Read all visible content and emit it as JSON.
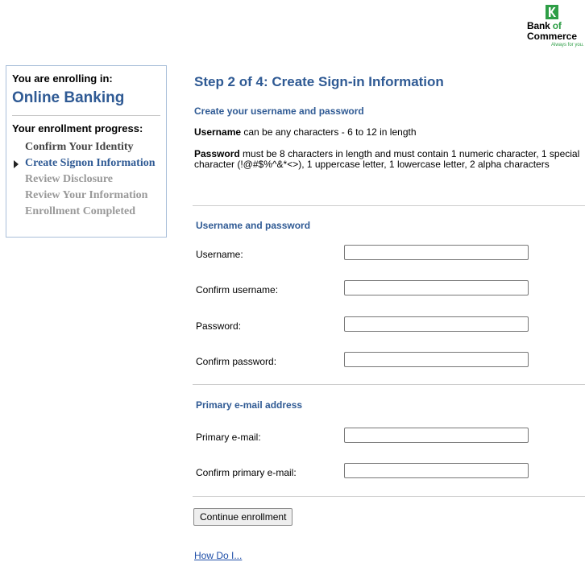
{
  "logo": {
    "line1_bank": "Bank",
    "line1_of": "of",
    "line2": "Commerce",
    "tagline": "Always for you.",
    "brand_color": "#2e9e46"
  },
  "sidebar": {
    "enrolling_label": "You are enrolling in:",
    "product": "Online Banking",
    "progress_label": "Your enrollment progress:",
    "steps": [
      {
        "label": "Confirm Your Identity",
        "state": "done"
      },
      {
        "label": "Create Signon Information",
        "state": "current"
      },
      {
        "label": "Review Disclosure",
        "state": "pending"
      },
      {
        "label": "Review Your Information",
        "state": "pending"
      },
      {
        "label": "Enrollment Completed",
        "state": "pending"
      }
    ]
  },
  "main": {
    "title": "Step 2 of 4: Create Sign-in Information",
    "subtitle": "Create your username and password",
    "username_rule_bold": "Username",
    "username_rule": " can be any characters - 6 to 12 in length",
    "password_rule_bold": "Password",
    "password_rule": " must be 8 characters in length and must contain 1 numeric character, 1 special character (!@#$%^&*<>), 1 uppercase letter, 1 lowercase letter, 2 alpha characters",
    "section1_title": "Username and password",
    "section2_title": "Primary e-mail address",
    "fields": {
      "username": {
        "label": "Username:",
        "value": ""
      },
      "confirm_username": {
        "label": "Confirm username:",
        "value": ""
      },
      "password": {
        "label": "Password:",
        "value": ""
      },
      "confirm_password": {
        "label": "Confirm password:",
        "value": ""
      },
      "email": {
        "label": "Primary e-mail:",
        "value": ""
      },
      "confirm_email": {
        "label": "Confirm primary e-mail:",
        "value": ""
      }
    },
    "continue_button": "Continue enrollment",
    "help_link": "How Do I..."
  },
  "colors": {
    "accent": "#2f5a94",
    "link": "#1f4fa8",
    "pending": "#999999"
  }
}
